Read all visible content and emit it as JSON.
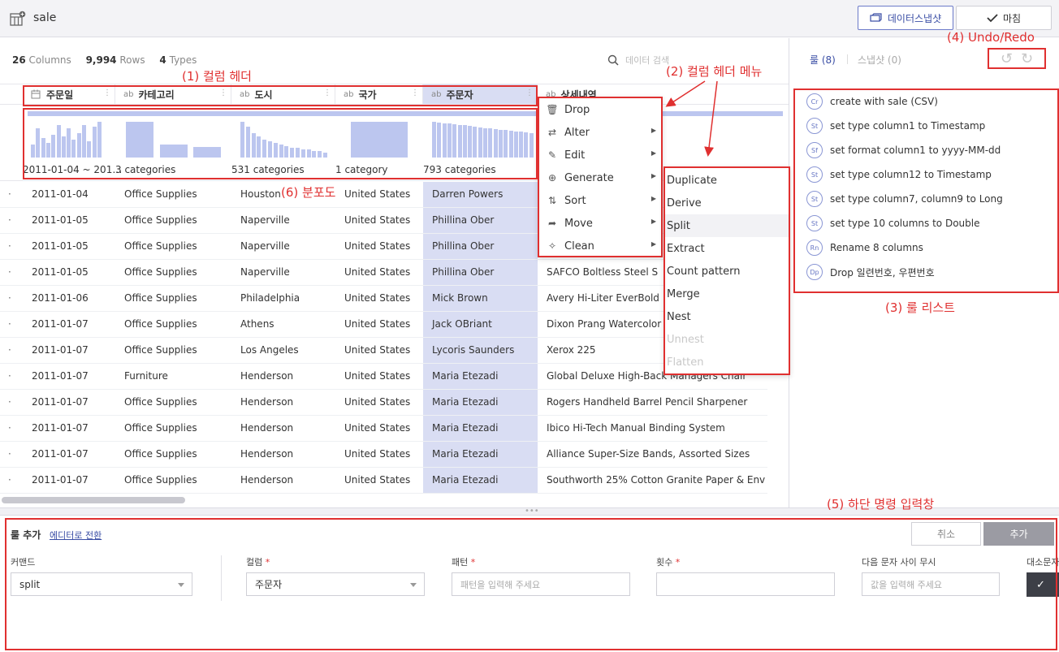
{
  "topbar": {
    "title": "sale",
    "snapshot_button": "데이터스냅샷",
    "done_button": "마침"
  },
  "stats": {
    "columns_count": "26",
    "columns_label": "Columns",
    "rows_count": "9,994",
    "rows_label": "Rows",
    "types_count": "4",
    "types_label": "Types"
  },
  "search": {
    "placeholder": "데이터 검색"
  },
  "columns": [
    {
      "type_icon": "calendar-icon",
      "name": "주문일"
    },
    {
      "type_icon": "ab",
      "name": "카테고리"
    },
    {
      "type_icon": "ab",
      "name": "도시"
    },
    {
      "type_icon": "ab",
      "name": "국가"
    },
    {
      "type_icon": "ab",
      "name": "주문자"
    },
    {
      "type_icon": "ab",
      "name": "상세내역"
    }
  ],
  "histograms": {
    "date_range": "2011-01-04 ~ 201…",
    "category_summary": "3 categories",
    "city_summary": "531 categories",
    "country_summary": "1 category",
    "customer_summary": "793 categories"
  },
  "rows": [
    [
      "2011-01-04",
      "Office Supplies",
      "Houston",
      "United States",
      "Darren Powers",
      ""
    ],
    [
      "2011-01-05",
      "Office Supplies",
      "Naperville",
      "United States",
      "Phillina Ober",
      ""
    ],
    [
      "2011-01-05",
      "Office Supplies",
      "Naperville",
      "United States",
      "Phillina Ober",
      ""
    ],
    [
      "2011-01-05",
      "Office Supplies",
      "Naperville",
      "United States",
      "Phillina Ober",
      "SAFCO Boltless Steel S"
    ],
    [
      "2011-01-06",
      "Office Supplies",
      "Philadelphia",
      "United States",
      "Mick Brown",
      "Avery Hi-Liter EverBold"
    ],
    [
      "2011-01-07",
      "Office Supplies",
      "Athens",
      "United States",
      "Jack OBriant",
      "Dixon Prang Watercolor"
    ],
    [
      "2011-01-07",
      "Office Supplies",
      "Los Angeles",
      "United States",
      "Lycoris Saunders",
      "Xerox 225"
    ],
    [
      "2011-01-07",
      "Furniture",
      "Henderson",
      "United States",
      "Maria Etezadi",
      "Global Deluxe High-Back Managers Chair"
    ],
    [
      "2011-01-07",
      "Office Supplies",
      "Henderson",
      "United States",
      "Maria Etezadi",
      "Rogers Handheld Barrel Pencil Sharpener"
    ],
    [
      "2011-01-07",
      "Office Supplies",
      "Henderson",
      "United States",
      "Maria Etezadi",
      "Ibico Hi-Tech Manual Binding System"
    ],
    [
      "2011-01-07",
      "Office Supplies",
      "Henderson",
      "United States",
      "Maria Etezadi",
      "Alliance Super-Size Bands, Assorted Sizes"
    ],
    [
      "2011-01-07",
      "Office Supplies",
      "Henderson",
      "United States",
      "Maria Etezadi",
      "Southworth 25% Cotton Granite Paper & Env"
    ]
  ],
  "right_panel": {
    "tab_rules": "룰 (8)",
    "tab_snapshots": "스냅샷 (0)",
    "rules": [
      {
        "icon": "Cr",
        "text": "create with sale (CSV)"
      },
      {
        "icon": "St",
        "text": "set type column1 to Timestamp"
      },
      {
        "icon": "Sf",
        "text": "set format column1 to yyyy-MM-dd"
      },
      {
        "icon": "St",
        "text": "set type column12 to Timestamp"
      },
      {
        "icon": "St",
        "text": "set type column7, column9 to Long"
      },
      {
        "icon": "St",
        "text": "set type 10 columns to Double"
      },
      {
        "icon": "Rn",
        "text": "Rename 8 columns"
      },
      {
        "icon": "Dp",
        "text": "Drop 일련번호, 우편번호"
      }
    ]
  },
  "header_menu": [
    {
      "icon": "trash-icon",
      "label": "Drop",
      "submenu": false
    },
    {
      "icon": "swap-icon",
      "label": "Alter",
      "submenu": true
    },
    {
      "icon": "edit-icon",
      "label": "Edit",
      "submenu": true
    },
    {
      "icon": "plus-circle-icon",
      "label": "Generate",
      "submenu": true
    },
    {
      "icon": "sort-icon",
      "label": "Sort",
      "submenu": true
    },
    {
      "icon": "arrow-right-icon",
      "label": "Move",
      "submenu": true
    },
    {
      "icon": "sparkle-icon",
      "label": "Clean",
      "submenu": true
    }
  ],
  "edit_submenu": [
    {
      "label": "Duplicate",
      "enabled": true
    },
    {
      "label": "Derive",
      "enabled": true
    },
    {
      "label": "Split",
      "enabled": true
    },
    {
      "label": "Extract",
      "enabled": true
    },
    {
      "label": "Count pattern",
      "enabled": true
    },
    {
      "label": "Merge",
      "enabled": true
    },
    {
      "label": "Nest",
      "enabled": true
    },
    {
      "label": "Unnest",
      "enabled": false
    },
    {
      "label": "Flatten",
      "enabled": false
    }
  ],
  "bottom": {
    "title": "룰 추가",
    "editor_link": "에디터로 전환",
    "cancel_button": "취소",
    "add_button": "추가",
    "command_label": "커맨드",
    "command_value": "split",
    "column_label": "컬럼",
    "column_value": "주문자",
    "pattern_label": "패턴",
    "pattern_placeholder": "패턴을 입력해 주세요",
    "count_label": "횟수",
    "count_value": "",
    "ignore_label": "다음 문자 사이 무시",
    "ignore_placeholder": "값을 입력해 주세요",
    "case_label": "대소문자",
    "required_mark": "*"
  },
  "annotations": {
    "column_header": "(1) 컬럼 헤더",
    "column_menu": "(2) 컬럼 헤더 메뉴",
    "rule_list": "(3) 룰 리스트",
    "undo_redo": "(4) Undo/Redo",
    "command_input": "(5) 하단 명령 입력창",
    "distribution": "(6) 분포도"
  },
  "colors": {
    "accent": "#3a4ea5",
    "selected_column": "#d9ddf3",
    "histogram_bar": "#bcc6ef",
    "annotation_red": "#e03030"
  }
}
